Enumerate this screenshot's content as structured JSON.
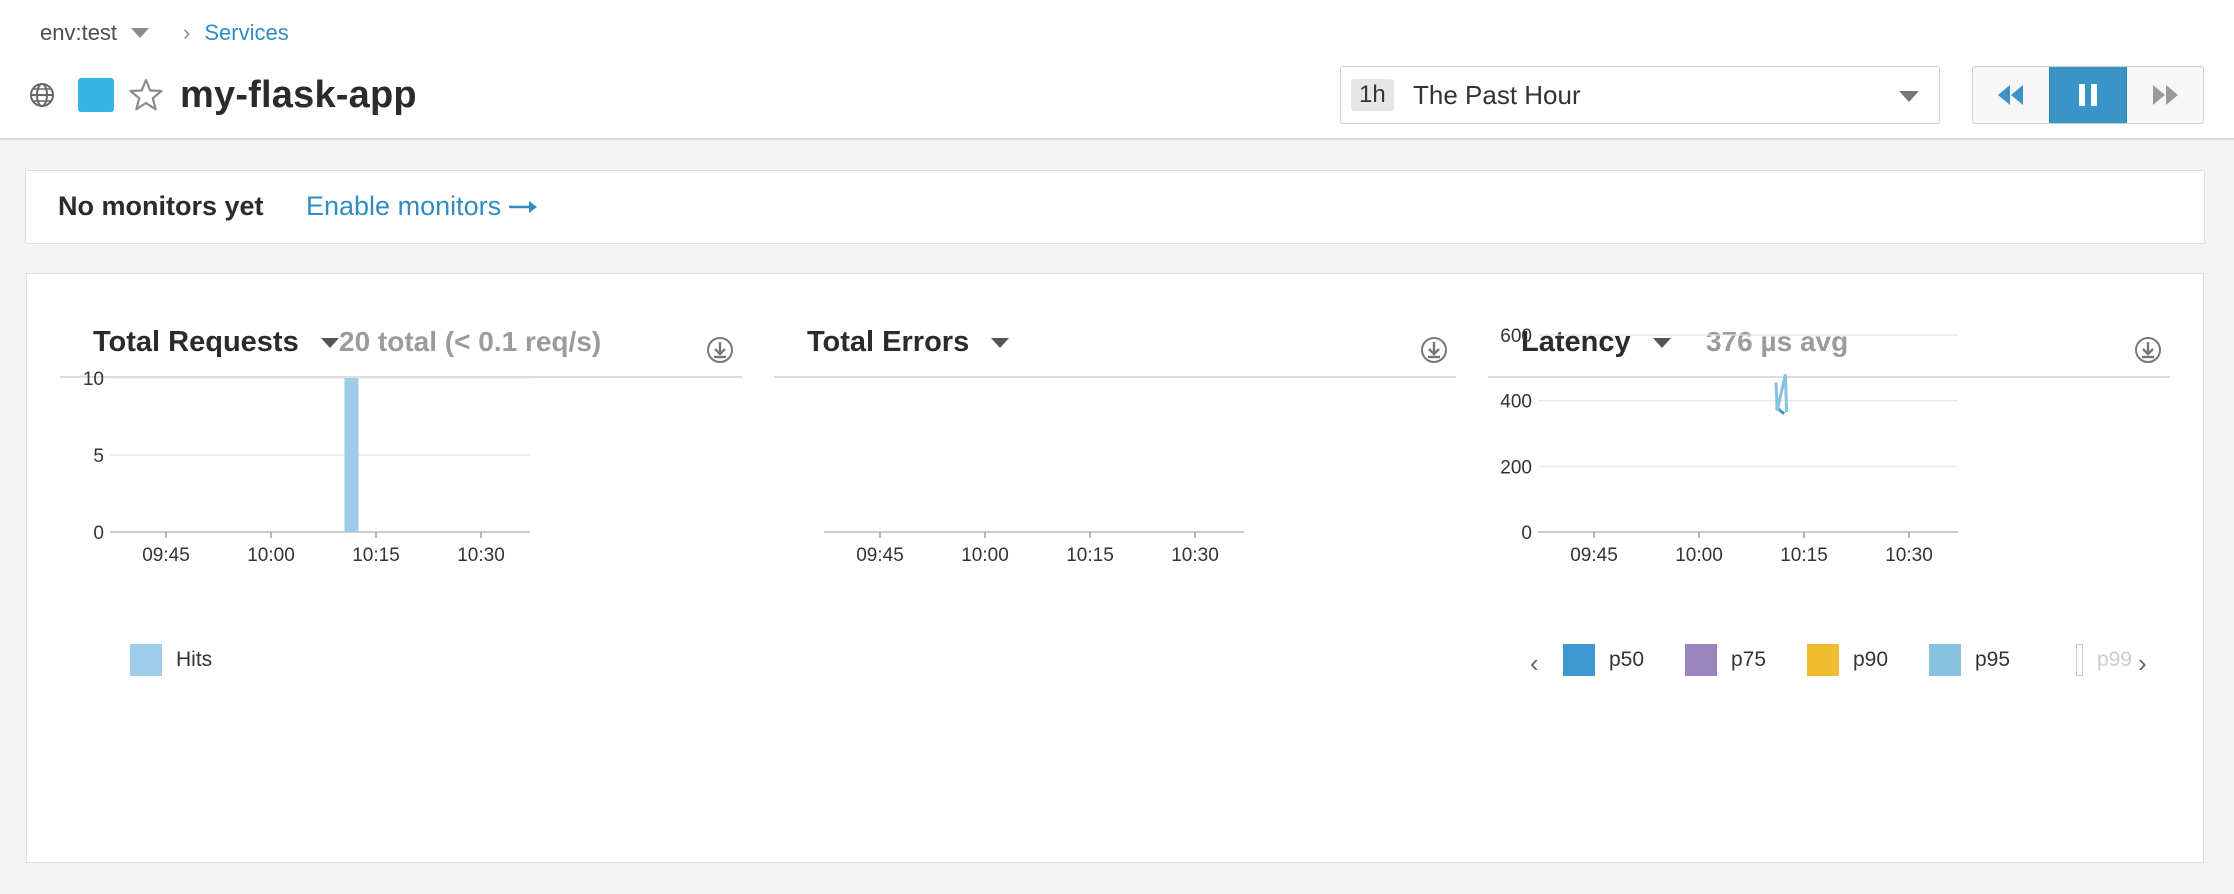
{
  "header": {
    "env": "env:test",
    "breadcrumb_services": "Services",
    "app_title": "my-flask-app",
    "app_color": "#35b5e3",
    "icons": [
      "globe-icon",
      "star-icon"
    ]
  },
  "time_selector": {
    "badge": "1h",
    "label": "The Past Hour",
    "icons": [
      "rewind-icon",
      "pause-icon",
      "fast-forward-icon"
    ],
    "active_color": "#3a94c9"
  },
  "monitors": {
    "status": "No monitors yet",
    "enable_link": "Enable monitors"
  },
  "widgets": [
    {
      "title": "Total Requests",
      "stat": "20 total (< 0.1 req/s)",
      "legend": [
        {
          "label": "Hits",
          "color": "#9dcde8"
        }
      ]
    },
    {
      "title": "Total Errors",
      "stat": "",
      "legend": []
    },
    {
      "title": "Latency",
      "stat": "376 µs avg",
      "legend": [
        {
          "label": "p50",
          "color": "#3d98cf"
        },
        {
          "label": "p75",
          "color": "#9a84bd"
        },
        {
          "label": "p90",
          "color": "#f0bb31"
        },
        {
          "label": "p95",
          "color": "#86c2e0"
        },
        {
          "label": "p99",
          "color": "#ffffff"
        }
      ]
    }
  ],
  "chart_data": [
    {
      "type": "bar",
      "title": "Total Requests",
      "x_ticks": [
        "09:45",
        "10:00",
        "10:15",
        "10:30"
      ],
      "y_ticks": [
        0,
        5,
        10
      ],
      "ylim": [
        0,
        10
      ],
      "xlim_minutes": [
        "09:37",
        "10:37"
      ],
      "series": [
        {
          "name": "Hits",
          "color": "#9dcde8",
          "points": [
            {
              "x": "10:11",
              "y": 10
            },
            {
              "x": "10:12",
              "y": 10
            }
          ]
        }
      ],
      "grid": true,
      "legend": "bottom-left"
    },
    {
      "type": "line",
      "title": "Total Errors",
      "x_ticks": [
        "09:45",
        "10:00",
        "10:15",
        "10:30"
      ],
      "y_ticks": [],
      "series": [],
      "grid": false
    },
    {
      "type": "line",
      "title": "Latency",
      "x_ticks": [
        "09:45",
        "10:00",
        "10:15",
        "10:30"
      ],
      "y_ticks": [
        0,
        200,
        400,
        600
      ],
      "ylim": [
        0,
        600
      ],
      "xlim_minutes": [
        "09:37",
        "10:37"
      ],
      "series": [
        {
          "name": "p50",
          "color": "#3d98cf",
          "points": [
            {
              "x": "10:11",
              "y": 380
            },
            {
              "x": "10:12",
              "y": 360
            }
          ]
        },
        {
          "name": "p95",
          "color": "#86c2e0",
          "points": [
            {
              "x": "10:11",
              "y": 455
            },
            {
              "x": "10:11",
              "y": 370
            },
            {
              "x": "10:12",
              "y": 480
            },
            {
              "x": "10:12",
              "y": 365
            }
          ]
        }
      ],
      "grid": true,
      "legend": "bottom"
    }
  ]
}
